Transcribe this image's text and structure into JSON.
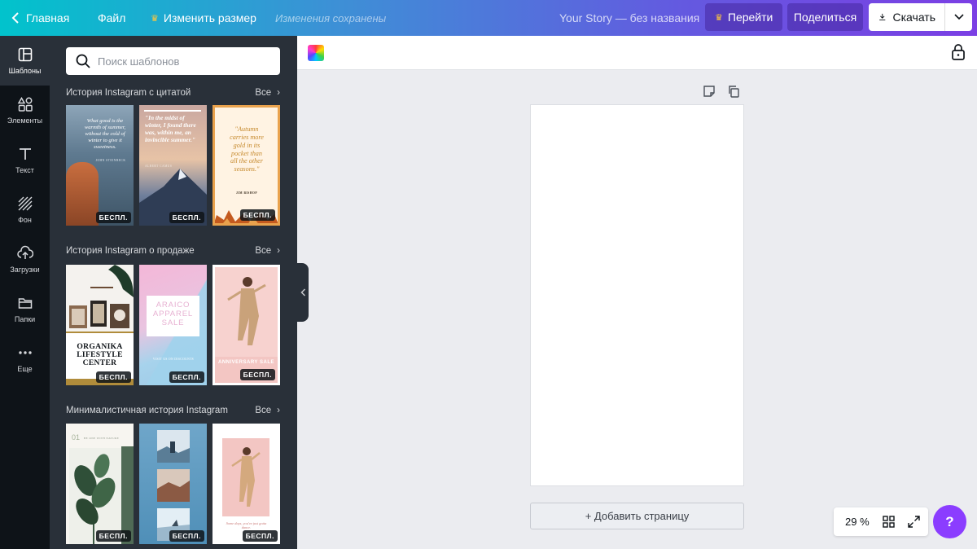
{
  "topbar": {
    "home_label": "Главная",
    "file_label": "Файл",
    "resize_label": "Изменить размер",
    "saved_status": "Изменения сохранены",
    "doc_title": "Your Story — без названия",
    "goto_label": "Перейти",
    "share_label": "Поделиться",
    "download_label": "Скачать"
  },
  "rail": {
    "items": [
      {
        "label": "Шаблоны",
        "icon": "layout-icon"
      },
      {
        "label": "Элементы",
        "icon": "shapes-icon"
      },
      {
        "label": "Текст",
        "icon": "text-icon"
      },
      {
        "label": "Фон",
        "icon": "background-icon"
      },
      {
        "label": "Загрузки",
        "icon": "upload-icon"
      },
      {
        "label": "Папки",
        "icon": "folder-icon"
      },
      {
        "label": "Еще",
        "icon": "more-icon"
      }
    ]
  },
  "panel": {
    "search_placeholder": "Поиск шаблонов",
    "see_all": "Все",
    "free_badge": "БЕСПЛ.",
    "sections": [
      {
        "title": "История Instagram с цитатой"
      },
      {
        "title": "История Instagram о продаже"
      },
      {
        "title": "Минималистичная история Instagram"
      }
    ],
    "thumbs": {
      "q1_text": "What good is the warmth of summer, without the cold of winter to give it sweetness.",
      "q1_author": "JOHN STEINBECK",
      "q2_text": "\"In the midst of winter, I found there was, within me, an invincible summer.\"",
      "q2_author": "ALBERT CAMUS",
      "q3_text": "\"Autumn carries more gold in its pocket than all the other seasons.\"",
      "q3_author": "JIM BISHOP",
      "s1_text": "ORGANIKA LIFESTYLE CENTER",
      "s2_text": "ARAICO APPAREL SALE",
      "s2_sub": "VISIT US ON DISCOUNTS",
      "s3_text": "ANNIVERSARY SALE",
      "m1_num": "01",
      "m1_text": "BE ONE WITH NATURE",
      "m3_text": "Some days, you've just gotta dance."
    }
  },
  "canvas": {
    "add_page_label": "+ Добавить страницу",
    "zoom": "29 %",
    "help_label": "?"
  },
  "colors": {
    "accent": "#8b3dff",
    "rail_bg": "#0e1318",
    "panel_bg": "#293039"
  }
}
